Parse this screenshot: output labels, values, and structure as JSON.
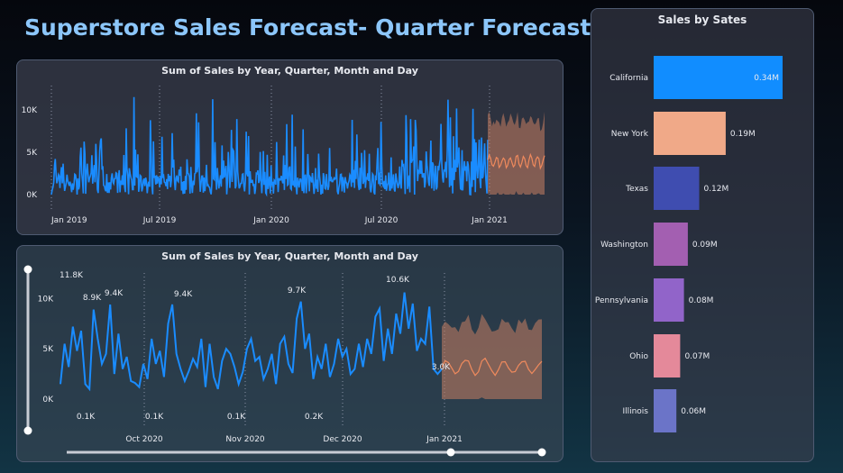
{
  "page_title": "Superstore Sales Forecast- Quarter Forecast",
  "colors": {
    "actual": "#1a8cff",
    "forecast_line": "#f08a5d",
    "forecast_band": "#c98062",
    "title": "#8cc6fa"
  },
  "chart_data": [
    {
      "type": "line",
      "title": "Sum of Sales by Year, Quarter, Month and Day",
      "x_tick_labels": [
        "Jan 2019",
        "Jul 2019",
        "Jan 2020",
        "Jul 2020",
        "Jan 2021"
      ],
      "y_tick_labels": [
        "10K",
        "5K",
        "0K"
      ],
      "ylim": [
        0,
        12000
      ],
      "grid": "vertical dotted at tick marks",
      "series": [
        {
          "name": "",
          "kind": "actual",
          "description": "daily sales, Jan 2019 – Dec 2020, mostly 0–6K with spikes to ~11.5K"
        },
        {
          "name": "",
          "kind": "forecast",
          "description": "forecast line ~3–5K with shaded confidence band ~0–9K, Jan 2021 – Mar 2021"
        }
      ]
    },
    {
      "type": "line",
      "title": "Sum of Sales by Year, Quarter, Month and Day",
      "x_tick_labels": [
        "Oct 2020",
        "Nov 2020",
        "Dec 2020",
        "Jan 2021"
      ],
      "y_tick_labels": [
        "10K",
        "5K",
        "0K"
      ],
      "ylim": [
        0,
        12000
      ],
      "data_labels": [
        "11.8K",
        "8.9K",
        "9.4K",
        "9.4K",
        "9.7K",
        "10.6K",
        "3.0K",
        "0.1K",
        "0.1K",
        "0.1K",
        "0.2K"
      ],
      "series": [
        {
          "name": "",
          "kind": "actual",
          "description": "daily sales Sep–Dec 2020 zoomed view"
        },
        {
          "name": "",
          "kind": "forecast",
          "description": "forecast ~2–4K with band ~0–8K, Jan–Mar 2021"
        }
      ],
      "zoom_slider": {
        "visible": true
      }
    },
    {
      "type": "bar",
      "orientation": "horizontal",
      "title": "Sales by Sates",
      "categories": [
        "California",
        "New York",
        "Texas",
        "Washington",
        "Pennsylvania",
        "Ohio",
        "Illinois"
      ],
      "values": [
        0.34,
        0.19,
        0.12,
        0.09,
        0.08,
        0.07,
        0.06
      ],
      "value_labels": [
        "0.34M",
        "0.19M",
        "0.12M",
        "0.09M",
        "0.08M",
        "0.07M",
        "0.06M"
      ],
      "colors": [
        "#118dff",
        "#f0a988",
        "#3f4db0",
        "#a35fb1",
        "#9164c9",
        "#e4899a",
        "#6b74c8"
      ]
    }
  ]
}
